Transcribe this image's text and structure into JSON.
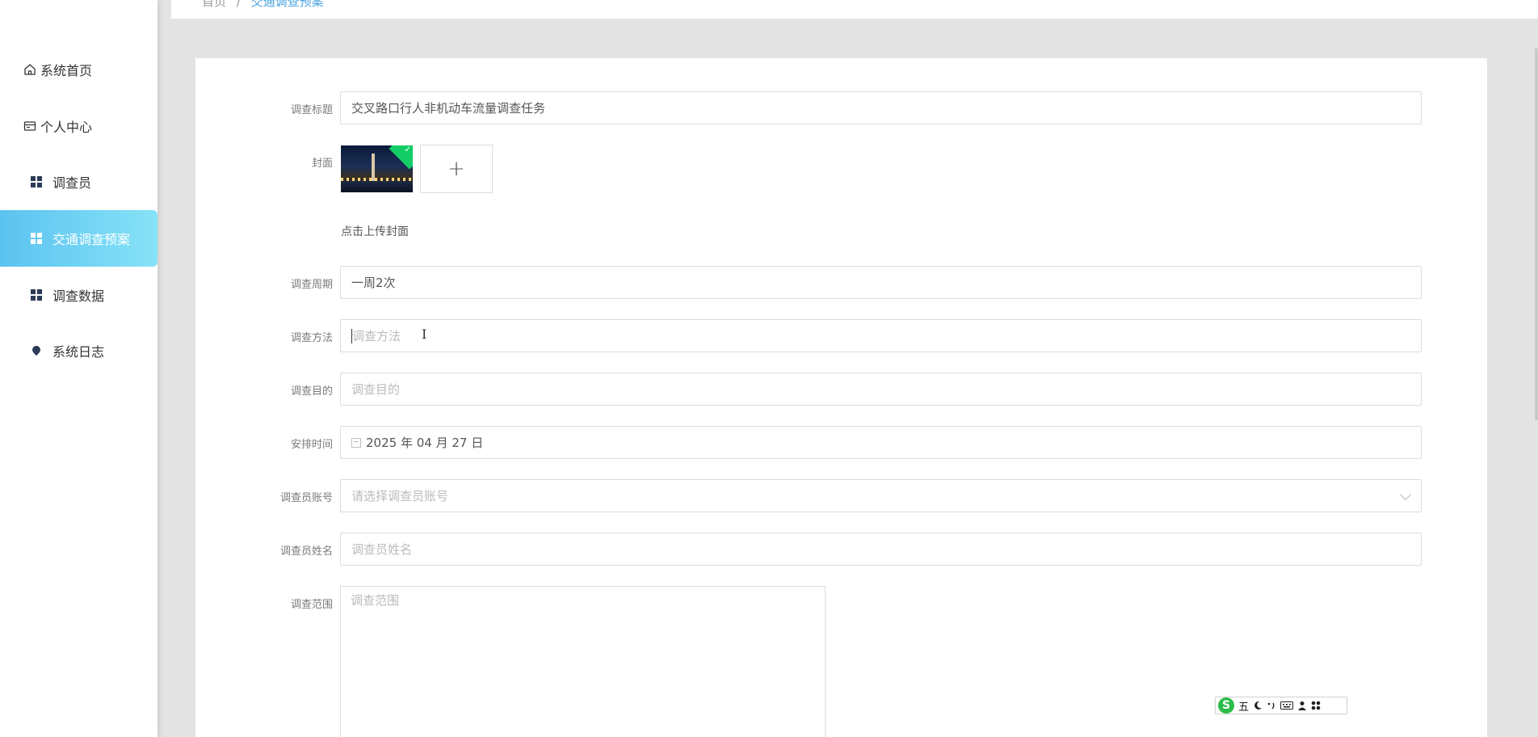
{
  "sidebar": {
    "items": [
      {
        "label": "系统首页",
        "icon": "home-icon"
      },
      {
        "label": "个人中心",
        "icon": "card-icon"
      },
      {
        "label": "调查员",
        "icon": "grid-icon"
      },
      {
        "label": "交通调查预案",
        "icon": "grid-icon",
        "active": true
      },
      {
        "label": "调查数据",
        "icon": "grid-icon"
      },
      {
        "label": "系统日志",
        "icon": "pin-icon"
      }
    ],
    "active_gradient": [
      "#5cc3f0",
      "#86e2f7"
    ]
  },
  "breadcrumb": {
    "home": "首页",
    "separator": "/",
    "current": "交通调查预案"
  },
  "form": {
    "title": {
      "label": "调查标题",
      "value": "交叉路口行人非机动车流量调查任务"
    },
    "cover": {
      "label": "封面",
      "hint": "点击上传封面",
      "add_symbol": "+"
    },
    "period": {
      "label": "调查周期",
      "value": "一周2次"
    },
    "method": {
      "label": "调查方法",
      "placeholder": "调查方法",
      "cursor_symbol": "I"
    },
    "purpose": {
      "label": "调查目的",
      "placeholder": "调查目的"
    },
    "schedule": {
      "label": "安排时间",
      "value": "2025 年 04 月 27 日"
    },
    "investigator_account": {
      "label": "调查员账号",
      "placeholder": "请选择调查员账号"
    },
    "investigator_name": {
      "label": "调查员姓名",
      "placeholder": "调查员姓名"
    },
    "scope": {
      "label": "调查范围",
      "placeholder": "调查范围"
    }
  },
  "ime": {
    "logo": "S",
    "mode": "五",
    "icons": [
      "moon-icon",
      "punctuation-icon",
      "keyboard-icon",
      "user-icon",
      "apps-icon"
    ]
  },
  "colors": {
    "accent": "#4aa3df",
    "upload_success": "#13ce66"
  }
}
